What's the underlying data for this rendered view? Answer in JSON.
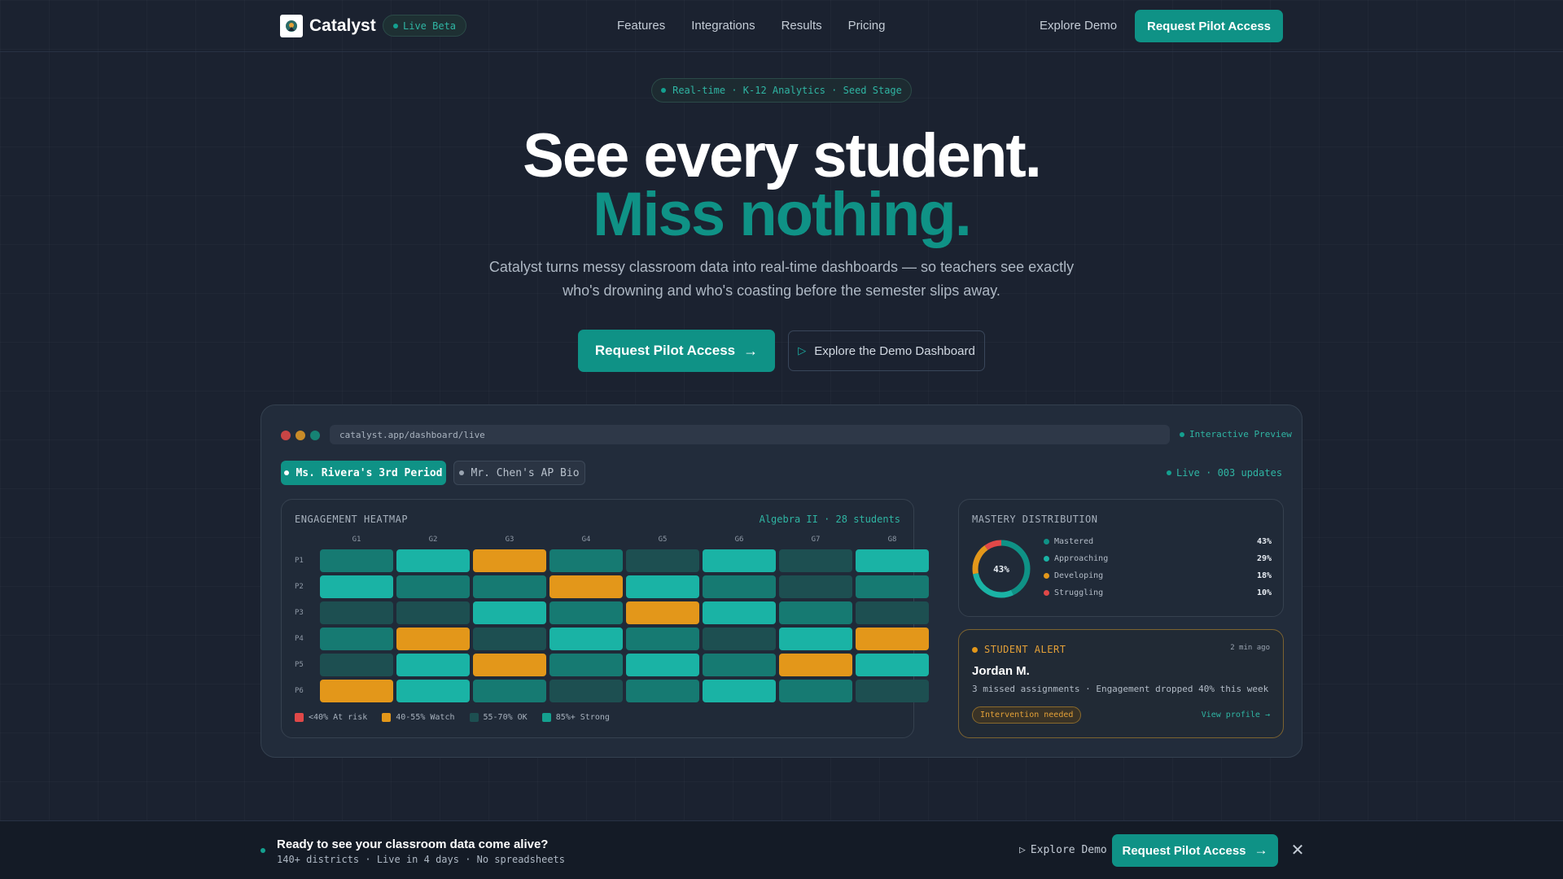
{
  "nav": {
    "brand": "Catalyst",
    "badge": "Live Beta",
    "links": [
      "Features",
      "Integrations",
      "Results",
      "Pricing"
    ],
    "demo": "Explore Demo",
    "cta": "Request Pilot Access"
  },
  "hero": {
    "pill": "Real-time · K-12 Analytics · Seed Stage",
    "title_line1": "See every student.",
    "title_line2": "Miss nothing.",
    "subtitle": "Catalyst turns messy classroom data into real-time dashboards — so teachers see exactly who's drowning and who's coasting before the semester slips away.",
    "cta": "Request Pilot Access",
    "demo": "Explore the Demo Dashboard"
  },
  "dashboard": {
    "url": "catalyst.app/dashboard/live",
    "preview": "Interactive Preview",
    "tabs": [
      "Ms. Rivera's 3rd Period",
      "Mr. Chen's AP Bio"
    ],
    "live": "Live · 003 updates",
    "heatmap": {
      "title": "ENGAGEMENT HEATMAP",
      "subtitle": "Algebra II · 28 students",
      "columns": [
        "G1",
        "G2",
        "G3",
        "G4",
        "G5",
        "G6",
        "G7",
        "G8"
      ],
      "rows": [
        "P1",
        "P2",
        "P3",
        "P4",
        "P5",
        "P6"
      ],
      "cells": [
        [
          "ok2",
          "strong",
          "watch",
          "ok2",
          "ok1",
          "strong",
          "ok1",
          "strong"
        ],
        [
          "strong",
          "ok2",
          "ok2",
          "watch",
          "strong",
          "ok2",
          "ok1",
          "ok2"
        ],
        [
          "ok1",
          "ok1",
          "strong",
          "ok2",
          "watch",
          "strong",
          "ok2",
          "ok1"
        ],
        [
          "ok2",
          "watch",
          "ok1",
          "strong",
          "ok2",
          "ok1",
          "strong",
          "watch"
        ],
        [
          "ok1",
          "strong",
          "watch",
          "ok2",
          "strong",
          "ok2",
          "watch",
          "strong"
        ],
        [
          "watch",
          "strong",
          "ok2",
          "ok1",
          "ok2",
          "strong",
          "ok2",
          "ok1"
        ]
      ],
      "legend": [
        {
          "label": "<40% At risk",
          "color": "#e04848"
        },
        {
          "label": "40-55% Watch",
          "color": "#e3971a"
        },
        {
          "label": "55-70% OK",
          "color": "#1d4f51"
        },
        {
          "label": "85%+ Strong",
          "color": "#14a08f"
        }
      ]
    },
    "mastery": {
      "title": "MASTERY DISTRIBUTION",
      "center": "43%",
      "items": [
        {
          "label": "Mastered",
          "pct": "43%",
          "value": 43,
          "color": "#0f9286"
        },
        {
          "label": "Approaching",
          "pct": "29%",
          "value": 29,
          "color": "#1ab3a5"
        },
        {
          "label": "Developing",
          "pct": "18%",
          "value": 18,
          "color": "#e3971a"
        },
        {
          "label": "Struggling",
          "pct": "10%",
          "value": 10,
          "color": "#e04848"
        }
      ]
    },
    "alert": {
      "title": "STUDENT ALERT",
      "time": "2 min ago",
      "name": "Jordan M.",
      "desc": "3 missed assignments · Engagement dropped 40% this week",
      "badge": "Intervention needed",
      "link": "View profile →"
    }
  },
  "bottom_bar": {
    "title": "Ready to see your classroom data come alive?",
    "subtitle": "140+ districts · Live in 4 days · No spreadsheets",
    "demo": "Explore Demo",
    "cta": "Request Pilot Access"
  },
  "colors": {
    "accent": "#0f9286",
    "watch": "#e3971a",
    "risk": "#e04848",
    "ok1": "#1d4f51",
    "ok2": "#167a72",
    "strong": "#1ab3a5"
  }
}
